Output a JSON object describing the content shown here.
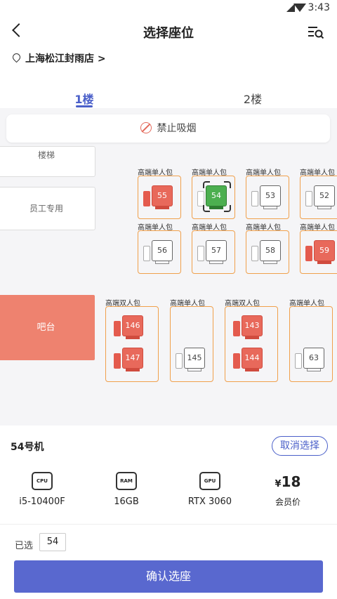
{
  "status": {
    "time": "3:43"
  },
  "header": {
    "title": "选择座位"
  },
  "store": {
    "name": "上海松江封雨店 >"
  },
  "tabs": [
    {
      "label": "1楼"
    },
    {
      "label": "2楼"
    }
  ],
  "notice": {
    "text": "禁止吸烟"
  },
  "rooms": {
    "stairs": "楼梯",
    "staff": "员工专用",
    "bar": "吧台"
  },
  "booths": [
    {
      "label": "高端单人包",
      "seats": [
        {
          "number": "55",
          "status": "occupied"
        }
      ]
    },
    {
      "label": "高端单人包",
      "seats": [
        {
          "number": "54",
          "status": "selected"
        }
      ]
    },
    {
      "label": "高端单人包",
      "seats": [
        {
          "number": "53",
          "status": "free"
        }
      ]
    },
    {
      "label": "高端单人包",
      "seats": [
        {
          "number": "52",
          "status": "free"
        }
      ]
    },
    {
      "label": "高端单人包",
      "seats": [
        {
          "number": "56",
          "status": "free"
        }
      ]
    },
    {
      "label": "高端单人包",
      "seats": [
        {
          "number": "57",
          "status": "free"
        }
      ]
    },
    {
      "label": "高端单人包",
      "seats": [
        {
          "number": "58",
          "status": "free"
        }
      ]
    },
    {
      "label": "高端单人包",
      "seats": [
        {
          "number": "59",
          "status": "occupied"
        }
      ]
    },
    {
      "label": "高端双人包",
      "seats": [
        {
          "number": "146",
          "status": "occupied"
        },
        {
          "number": "147",
          "status": "occupied"
        }
      ]
    },
    {
      "label": "高端单人包",
      "seats": [
        {
          "number": "145",
          "status": "free"
        }
      ]
    },
    {
      "label": "高端双人包",
      "seats": [
        {
          "number": "143",
          "status": "occupied"
        },
        {
          "number": "144",
          "status": "occupied"
        }
      ]
    },
    {
      "label": "高端单人包",
      "seats": [
        {
          "number": "63",
          "status": "free"
        }
      ]
    }
  ],
  "machine": {
    "name": "54号机",
    "cancel_label": "取消选择",
    "specs": [
      {
        "icon": "cpu-icon",
        "icon_text": "CPU",
        "value": "i5-10400F"
      },
      {
        "icon": "ram-icon",
        "icon_text": "RAM",
        "value": "16GB"
      },
      {
        "icon": "gpu-icon",
        "icon_text": "GPU",
        "value": "RTX 3060"
      }
    ],
    "price_symbol": "¥",
    "price": "18",
    "price_label": "会员价"
  },
  "selection": {
    "label": "已选",
    "value": "54"
  },
  "confirm_label": "确认选座",
  "colors": {
    "accent": "#4a5fc9",
    "occupied": "#e8695b",
    "selected": "#4caf50",
    "booth_border": "#f0a04b"
  }
}
